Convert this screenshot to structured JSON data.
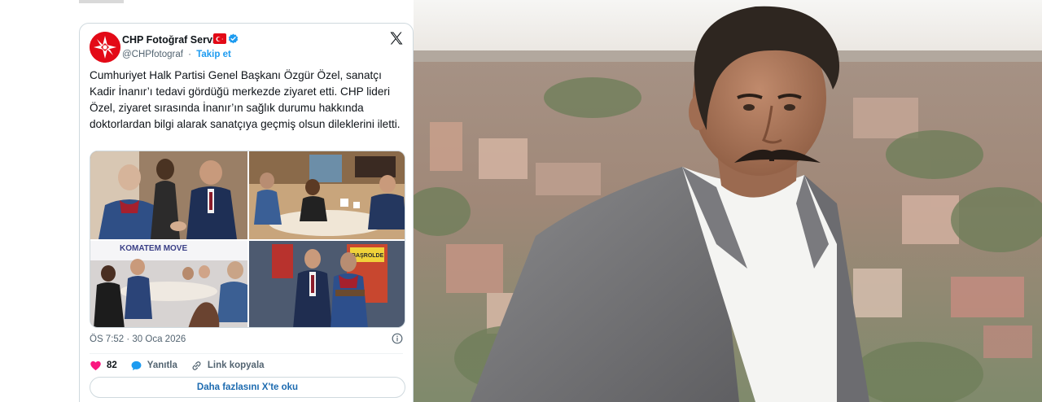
{
  "tweet": {
    "author_name": "CHP Fotoğraf Servisi",
    "handle": "@CHPfotograf",
    "separator": "·",
    "follow_label": "Takip et",
    "text": "Cumhuriyet Halk Partisi Genel Başkanı Özgür Özel, sanatçı Kadir İnanır’ı tedavi gördüğü merkezde ziyaret etti. CHP lideri Özel, ziyaret sırasında İnanır’ın sağlık durumu hakkında doktorlardan bilgi alarak sanatçıya geçmiş olsun dileklerini iletti.",
    "timestamp": "ÖS 7:52 · 30 Oca 2026",
    "like_count": "82",
    "reply_label": "Yanıtla",
    "copy_link_label": "Link kopyala",
    "read_more_label": "Daha fazlasını X'te oku",
    "photo_signs": {
      "banner": "KOMATEM MOVE",
      "poster": "BAŞROLDE"
    }
  },
  "colors": {
    "brand_red": "#e30a17",
    "link_blue": "#1d9bf0",
    "read_more_blue": "#1d6bb0",
    "like_pink": "#f91880",
    "text_primary": "#0f1419",
    "text_secondary": "#536471",
    "border": "#cfd9de"
  },
  "icons": [
    "chp-logo-icon",
    "turkish-flag-icon",
    "verified-badge-icon",
    "x-logo-icon",
    "info-icon",
    "heart-icon",
    "reply-icon",
    "link-icon"
  ]
}
